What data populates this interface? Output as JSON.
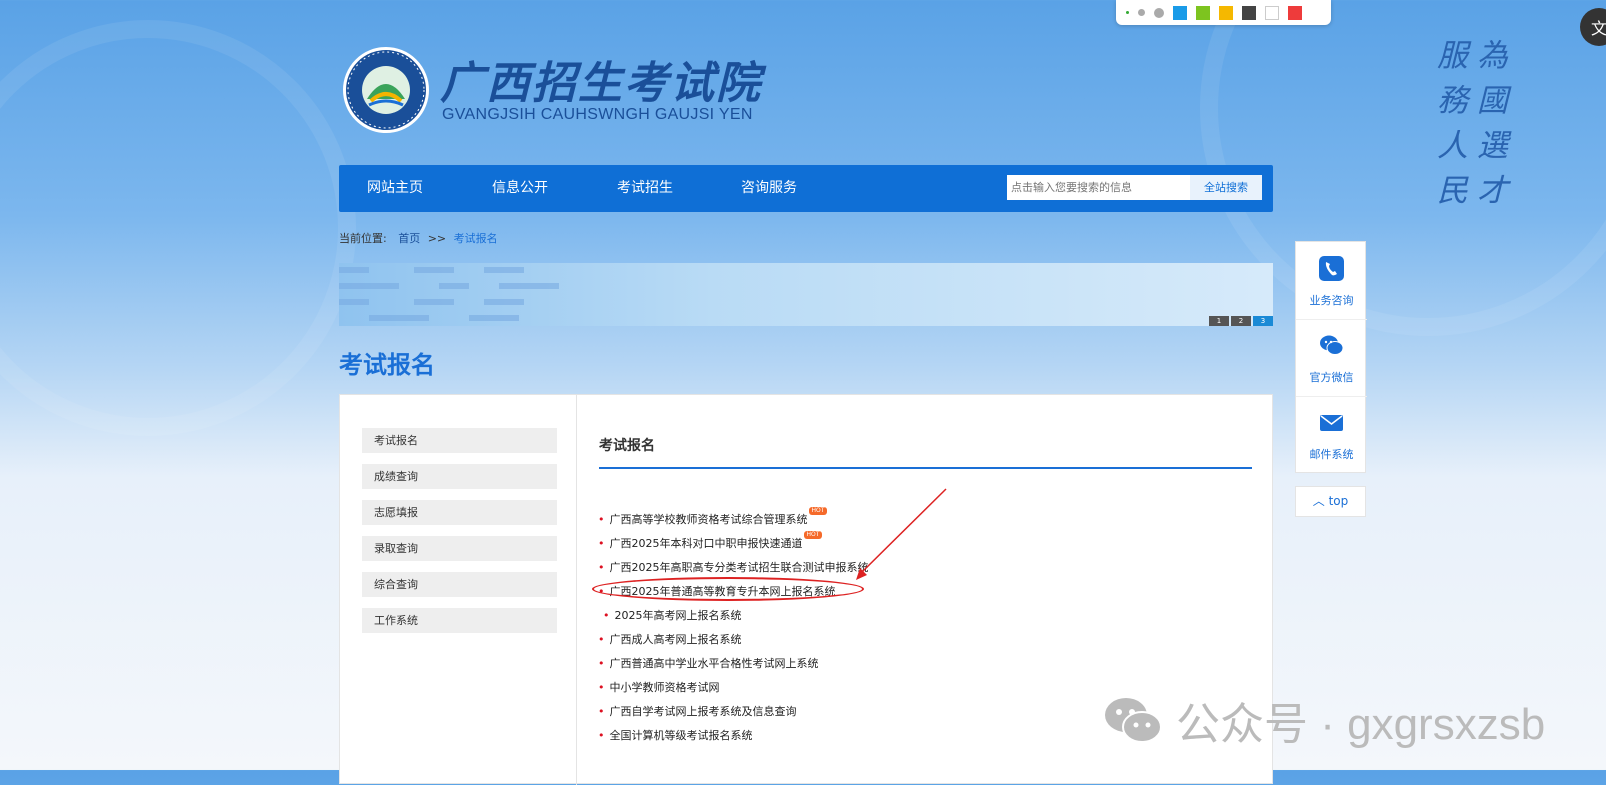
{
  "brand": {
    "name": "广西招生考试院",
    "english_name": "GVANGJSIH CAUHSWNGH GAUJSI YEN",
    "slogan": [
      "為",
      "服",
      "國",
      "務",
      "選",
      "人",
      "才",
      "民"
    ]
  },
  "nav": {
    "items": [
      "网站主页",
      "信息公开",
      "考试招生",
      "咨询服务"
    ],
    "search_placeholder": "点击输入您要搜索的信息",
    "search_button": "全站搜索"
  },
  "breadcrumb": {
    "label": "当前位置:",
    "home": "首页",
    "sep": ">>",
    "current": "考试报名"
  },
  "banner": {
    "pages": [
      "1",
      "2",
      "3"
    ],
    "active_page": 3
  },
  "page_title": "考试报名",
  "sidebar": {
    "items": [
      "考试报名",
      "成绩查询",
      "志愿填报",
      "录取查询",
      "综合查询",
      "工作系统"
    ]
  },
  "section": {
    "title": "考试报名",
    "links": [
      {
        "text": "广西高等学校教师资格考试综合管理系统",
        "hot": true
      },
      {
        "text": "广西2025年本科对口中职申报快速通道",
        "hot": true
      },
      {
        "text": "广西2025年高职高专分类考试招生联合测试申报系统",
        "hot": false
      },
      {
        "text": "广西2025年普通高等教育专升本网上报名系统",
        "hot": false
      },
      {
        "text": "2025年高考网上报名系统",
        "hot": false
      },
      {
        "text": "广西成人高考网上报名系统",
        "hot": false
      },
      {
        "text": "广西普通高中学业水平合格性考试网上系统",
        "hot": false
      },
      {
        "text": "中小学教师资格考试网",
        "hot": false
      },
      {
        "text": "广西自学考试网上报考系统及信息查询",
        "hot": false
      },
      {
        "text": "全国计算机等级考试报名系统",
        "hot": false
      }
    ],
    "hot_label": "HOT"
  },
  "right_panel": {
    "items": [
      {
        "label": "业务咨询",
        "icon": "phone-icon"
      },
      {
        "label": "官方微信",
        "icon": "wechat-icon"
      },
      {
        "label": "邮件系统",
        "icon": "mail-icon"
      }
    ],
    "top_label": "top"
  },
  "watermark": {
    "text": "公众号 · gxgrsxzsb"
  },
  "colors": {
    "primary": "#0f6fd6",
    "swatches": [
      "#1a9be8",
      "#7dc41f",
      "#f5b800",
      "#444444",
      "#ffffff",
      "#ee3b3b"
    ]
  }
}
